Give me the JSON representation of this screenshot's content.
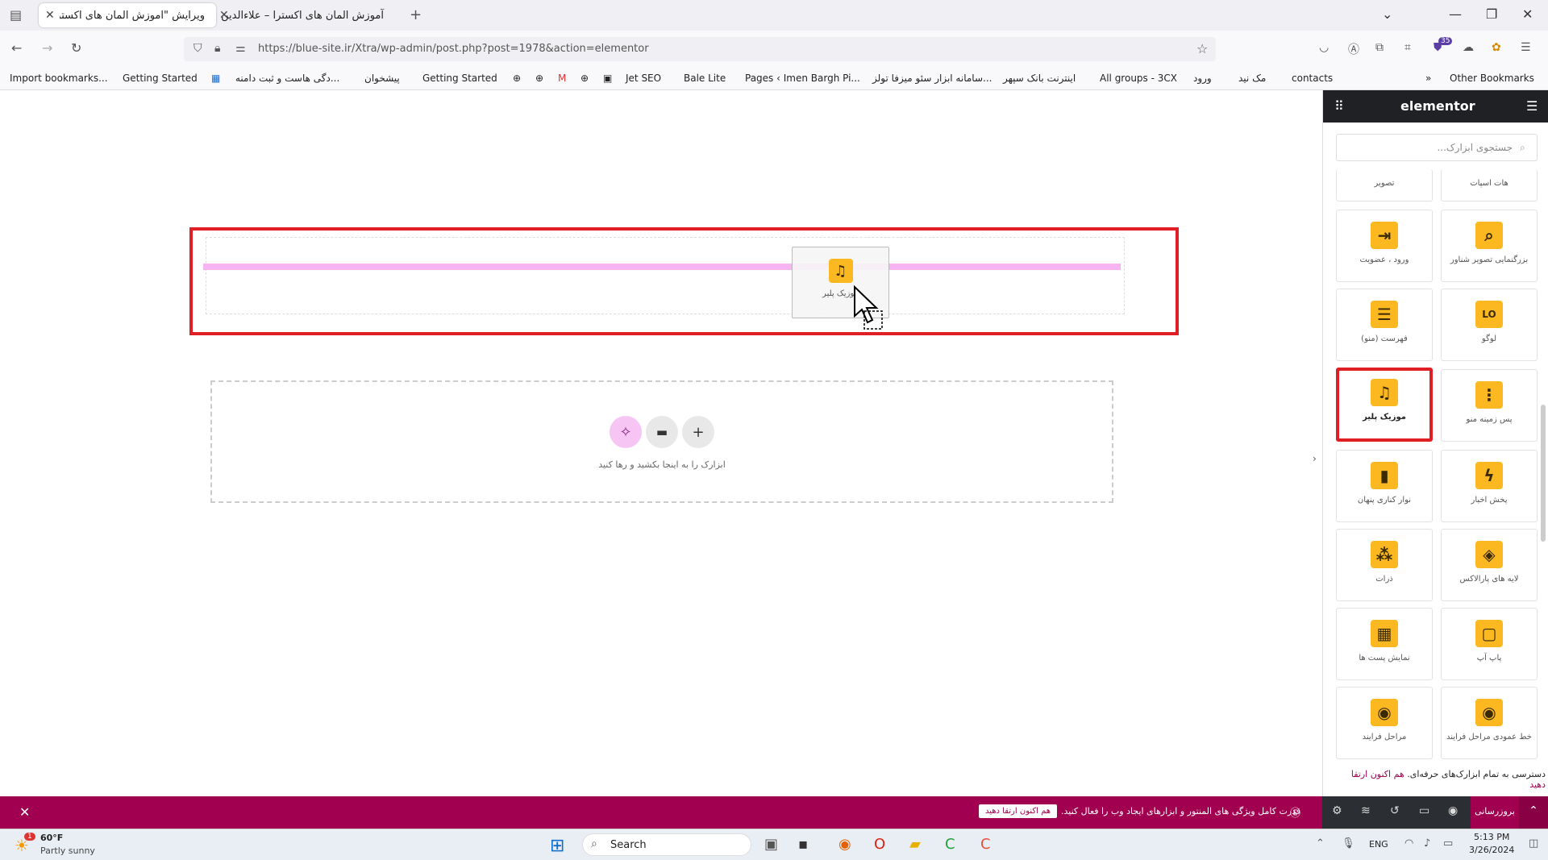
{
  "browser": {
    "tabs": [
      {
        "title": "ویرایش \"آموزش المان های اکسترا - ع",
        "active": true
      },
      {
        "title": "آموزش المان های اکسترا – علاءالدین",
        "active": false
      }
    ],
    "url": "https://blue-site.ir/Xtra/wp-admin/post.php?post=1978&action=elementor",
    "url_host": "blue-site.ir",
    "bookmarks": [
      "Import bookmarks...",
      "Getting Started",
      "...دگی هاست و ثبت دامنه",
      "پیشخوان",
      "Getting Started",
      "Jet SEO",
      "Bale Lite",
      "Pages ‹ Imen Bargh Pi...",
      "...سامانه ابزار سئو میزفا تولز",
      "اینترنت بانک سپهر",
      "All groups - 3CX",
      "ورود",
      "مک نید",
      "contacts"
    ],
    "other_bookmarks": "Other Bookmarks",
    "extension_badge": "35"
  },
  "canvas": {
    "drag_widget_label": "موزیک پلیر",
    "drop_hint": "ابزارک را به اینجا بکشید و رها کنید"
  },
  "sidebar": {
    "brand": "elementor",
    "search_placeholder": "جستجوی ابزارک...",
    "partial_labels": [
      "هات اسپات",
      "تصویر"
    ],
    "widgets": [
      {
        "label": "بزرگنمایی تصویر شناور",
        "icon": "zoom-image-icon",
        "glyph": "⌕"
      },
      {
        "label": "ورود ، عضویت",
        "icon": "login-icon",
        "glyph": "⇥"
      },
      {
        "label": "لوگو",
        "icon": "logo-icon",
        "glyph": "LO"
      },
      {
        "label": "فهرست (منو)",
        "icon": "menu-icon",
        "glyph": "☰"
      },
      {
        "label": "پس زمینه منو",
        "icon": "menu-background-icon",
        "glyph": "⋮"
      },
      {
        "label": "موزیک پلیر",
        "icon": "music-note-icon",
        "glyph": "♫"
      },
      {
        "label": "پخش اخبار",
        "icon": "lightning-icon",
        "glyph": "ϟ"
      },
      {
        "label": "نوار کناری پنهان",
        "icon": "hidden-sidebar-icon",
        "glyph": "▮"
      },
      {
        "label": "لایه های پارالاکس",
        "icon": "layers-icon",
        "glyph": "◈"
      },
      {
        "label": "ذرات",
        "icon": "particles-icon",
        "glyph": "⁂"
      },
      {
        "label": "پاپ آپ",
        "icon": "popup-icon",
        "glyph": "▢"
      },
      {
        "label": "نمایش پست ها",
        "icon": "posts-grid-icon",
        "glyph": "▦"
      },
      {
        "label": "خط عمودی مراحل فرایند",
        "icon": "vertical-timeline-icon",
        "glyph": "◉"
      },
      {
        "label": "مراحل فرایند",
        "icon": "process-steps-icon",
        "glyph": "◉"
      }
    ],
    "promo_text": "دسترسی به تمام ابزارک‌های حرفه‌ای.",
    "promo_link": "هم اکنون ارتقا دهید",
    "update_button": "بروزرسانی"
  },
  "notice": {
    "text": "قدرت کامل ویژگی های المنتور و ابزارهای ایجاد وب را فعال کنید.",
    "button": "هم اکنون ارتقا دهید"
  },
  "taskbar": {
    "weather_temp": "60°F",
    "weather_desc": "Partly sunny",
    "weather_badge": "1",
    "search_label": "Search",
    "lang": "ENG",
    "time": "5:13 PM",
    "date": "3/26/2024"
  }
}
